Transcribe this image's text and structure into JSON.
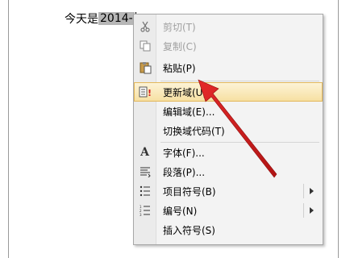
{
  "document": {
    "text": "今天是 ",
    "selected_text": "2014-"
  },
  "context_menu": {
    "items": [
      {
        "id": "cut",
        "label": "剪切(T)",
        "icon": "scissors-icon",
        "disabled": true
      },
      {
        "id": "copy",
        "label": "复制(C)",
        "icon": "copy-icon",
        "disabled": true
      },
      {
        "id": "paste",
        "label": "粘贴(P)",
        "icon": "paste-icon",
        "disabled": false
      },
      {
        "id": "update",
        "label": "更新域(U)",
        "icon": "update-field-icon",
        "disabled": false
      },
      {
        "id": "edit",
        "label": "编辑域(E)...",
        "icon": "",
        "disabled": false
      },
      {
        "id": "toggle",
        "label": "切换域代码(T)",
        "icon": "",
        "disabled": false
      },
      {
        "id": "font",
        "label": "字体(F)...",
        "icon": "font-icon",
        "disabled": false
      },
      {
        "id": "paragraph",
        "label": "段落(P)...",
        "icon": "paragraph-icon",
        "disabled": false
      },
      {
        "id": "bullets",
        "label": "项目符号(B)",
        "icon": "bullets-icon",
        "disabled": false,
        "submenu": true
      },
      {
        "id": "numbering",
        "label": "编号(N)",
        "icon": "numbering-icon",
        "disabled": false,
        "submenu": true
      },
      {
        "id": "symbol",
        "label": "插入符号(S)",
        "icon": "",
        "disabled": false
      }
    ]
  },
  "colors": {
    "menu_bg": "#f3f3f3",
    "arrow": "#d81e1e",
    "hover": "#f6dfa0"
  }
}
